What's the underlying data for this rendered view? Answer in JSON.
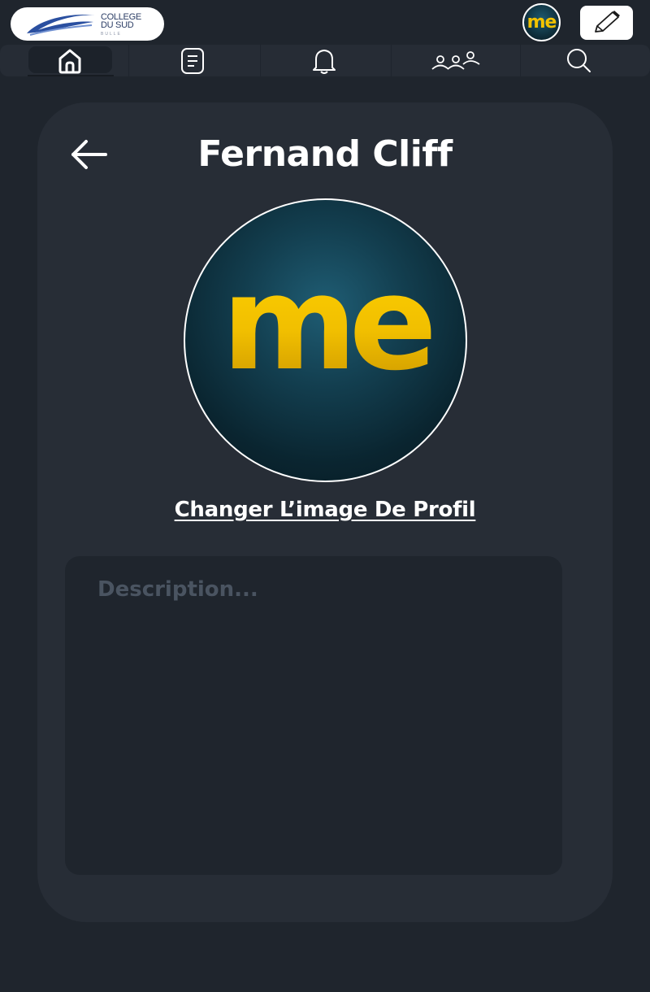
{
  "header": {
    "logo": {
      "line1": "COLLEGE",
      "line2": "DU SUD",
      "line3": "BULLE"
    },
    "avatar_text": "me",
    "edit_icon": "pencil-icon"
  },
  "nav": {
    "items": [
      {
        "icon": "home-icon",
        "active": true
      },
      {
        "icon": "document-icon",
        "active": false
      },
      {
        "icon": "bell-icon",
        "active": false
      },
      {
        "icon": "group-icon",
        "active": false
      },
      {
        "icon": "search-icon",
        "active": false
      }
    ]
  },
  "profile": {
    "back_icon": "arrow-left-icon",
    "name": "Fernand Cliff",
    "avatar_text": "me",
    "change_picture_label": "Changer L’image De Profil",
    "description_placeholder": "Description..."
  },
  "colors": {
    "background": "#1f252d",
    "card": "#272d36",
    "accent_yellow": "#f2c200",
    "avatar_teal": "#133f50"
  }
}
